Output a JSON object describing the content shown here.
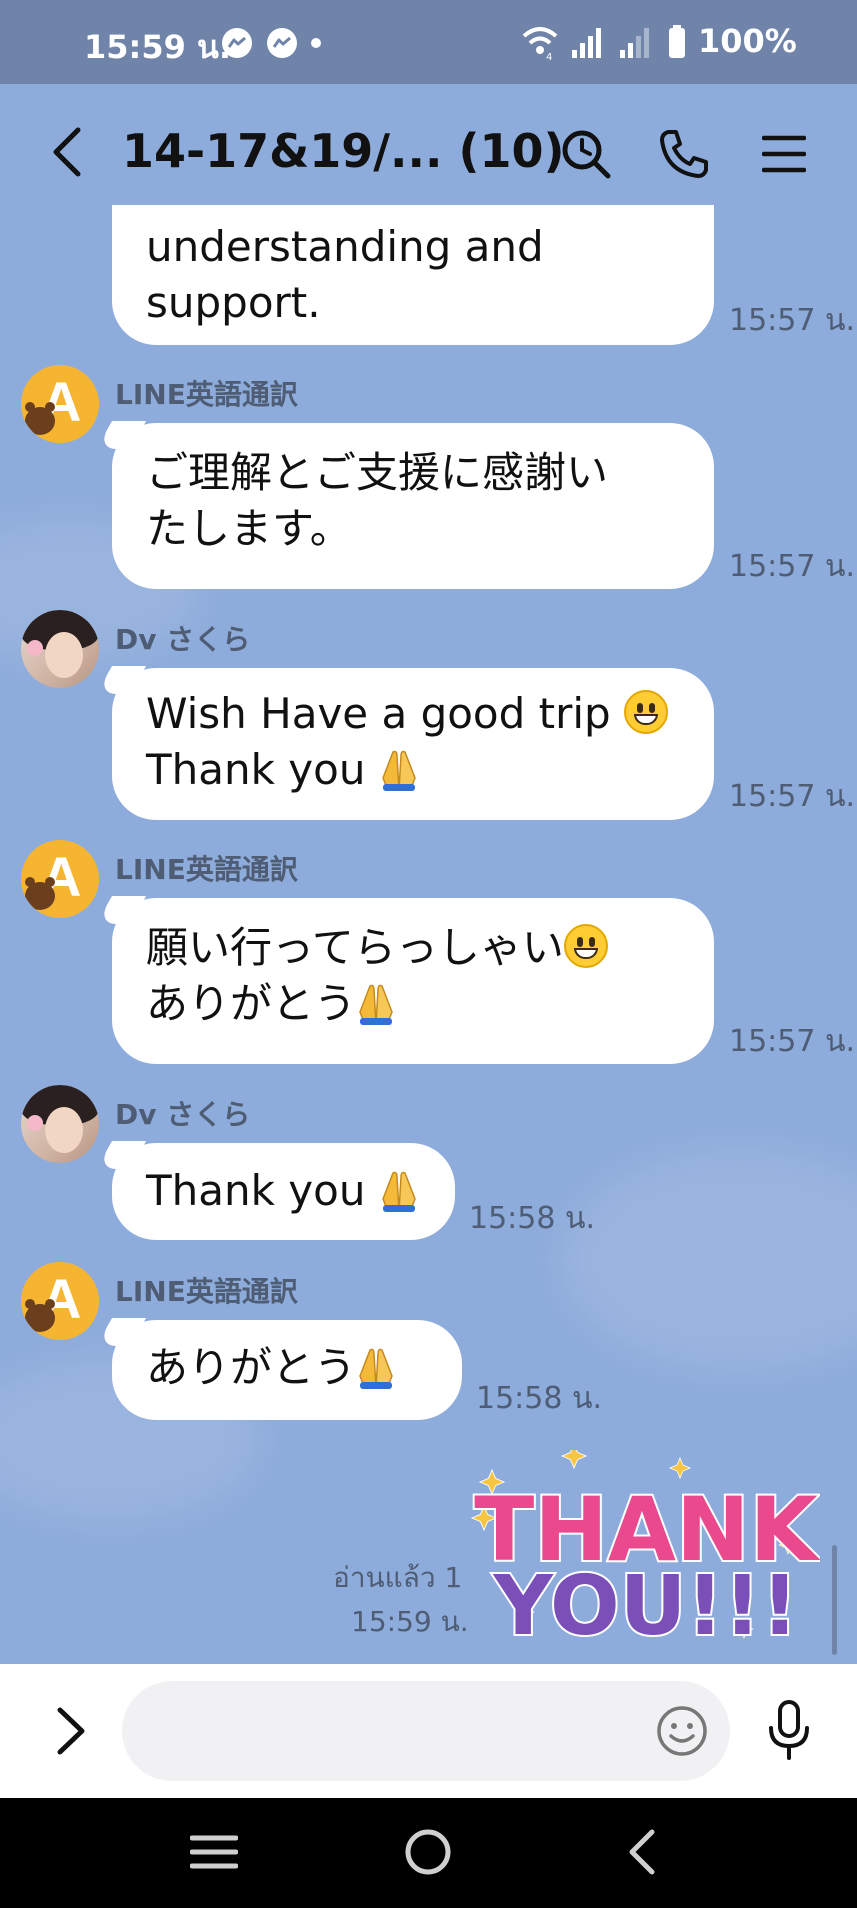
{
  "status_bar": {
    "time": "15:59 น.",
    "battery": "100%",
    "icons": [
      "messenger-icon",
      "messenger-icon",
      "notification-dot-icon",
      "wifi-icon",
      "signal-icon",
      "signal-weak-icon",
      "battery-icon"
    ]
  },
  "header": {
    "title": "14-17&19/... (10)",
    "icons": [
      "back-icon",
      "search-icon",
      "call-icon",
      "menu-icon"
    ]
  },
  "messages": [
    {
      "sender": "",
      "lines": [
        "understanding and",
        "support."
      ],
      "time": "15:57 น."
    },
    {
      "sender": "LINE英語通訳",
      "lines": [
        "ご理解とご支援に感謝い",
        "たします。"
      ],
      "time": "15:57 น."
    },
    {
      "sender": "Dv さくら",
      "lines": [
        "Wish  Have a good trip",
        "Thank you"
      ],
      "time": "15:57 น."
    },
    {
      "sender": "LINE英語通訳",
      "lines": [
        "願い行ってらっしゃい",
        "ありがとう"
      ],
      "time": "15:57 น."
    },
    {
      "sender": "Dv さくら",
      "lines": [
        "Thank you"
      ],
      "time": "15:58 น."
    },
    {
      "sender": "LINE英語通訳",
      "lines": [
        "ありがとう"
      ],
      "time": "15:58 น."
    }
  ],
  "own_message": {
    "sticker": "THANK YOU!!!",
    "read_status": "อ่านแล้ว 1",
    "time": "15:59 น."
  },
  "input_bar": {
    "placeholder": "",
    "icons": [
      "expand-icon",
      "emoji-icon",
      "microphone-icon"
    ]
  },
  "nav_bar": {
    "icons": [
      "recent-apps-icon",
      "home-icon",
      "back-icon"
    ]
  },
  "colors": {
    "chat_background": "#8eacdb",
    "status_bar": "#6f84a8",
    "bubble": "#ffffff",
    "timestamp_text": "#4e5c74",
    "translator_avatar": "#f6b531"
  }
}
